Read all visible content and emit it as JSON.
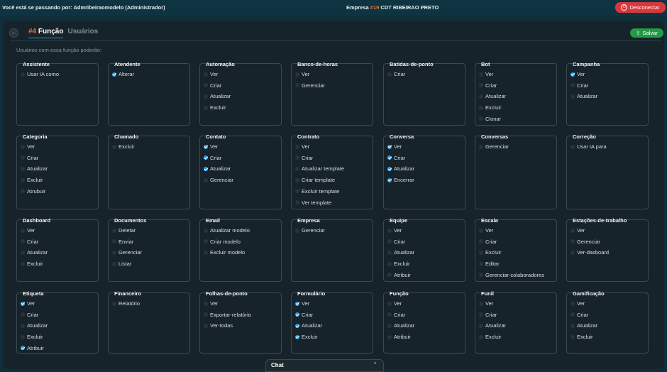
{
  "topbar": {
    "user_prefix": "Você está se passando por: ",
    "user_name": "Admribeiraomodelo (Administrador)",
    "company_prefix": "Empresa ",
    "company_num": "#19",
    "company_name": " CDT RIBEIRAO PRETO",
    "disconnect_label": "Desconectar"
  },
  "header": {
    "role_num": "#4",
    "tab_function": "Função",
    "tab_users": "Usuários",
    "save_label": "Salvar"
  },
  "subtitle": "Usuários com essa função poderão:",
  "colors": {
    "accent": "#2aa0e8",
    "danger": "#d6383c",
    "success": "#239a46",
    "orange": "#e2703a"
  },
  "cards": [
    {
      "title": "Assistente",
      "perms": [
        {
          "label": "Usar IA como",
          "on": false
        }
      ]
    },
    {
      "title": "Atendente",
      "perms": [
        {
          "label": "Alterar",
          "on": true
        }
      ]
    },
    {
      "title": "Automação",
      "perms": [
        {
          "label": "Ver",
          "on": false
        },
        {
          "label": "Criar",
          "on": false
        },
        {
          "label": "Atualizar",
          "on": false
        },
        {
          "label": "Excluir",
          "on": false
        }
      ]
    },
    {
      "title": "Banco-de-horas",
      "perms": [
        {
          "label": "Ver",
          "on": false
        },
        {
          "label": "Gerenciar",
          "on": false
        }
      ]
    },
    {
      "title": "Batidas-de-ponto",
      "perms": [
        {
          "label": "Criar",
          "on": false
        }
      ]
    },
    {
      "title": "Bot",
      "perms": [
        {
          "label": "Ver",
          "on": false
        },
        {
          "label": "Criar",
          "on": false
        },
        {
          "label": "Atualizar",
          "on": false
        },
        {
          "label": "Excluir",
          "on": false
        },
        {
          "label": "Clonar",
          "on": false
        }
      ]
    },
    {
      "title": "Campanha",
      "perms": [
        {
          "label": "Ver",
          "on": true
        },
        {
          "label": "Criar",
          "on": false
        },
        {
          "label": "Atualizar",
          "on": false
        }
      ]
    },
    {
      "title": "Categoria",
      "perms": [
        {
          "label": "Ver",
          "on": false
        },
        {
          "label": "Criar",
          "on": false
        },
        {
          "label": "Atualizar",
          "on": false
        },
        {
          "label": "Excluir",
          "on": false
        },
        {
          "label": "Atrubuir",
          "on": false
        }
      ]
    },
    {
      "title": "Chamado",
      "perms": [
        {
          "label": "Excluir",
          "on": false
        }
      ]
    },
    {
      "title": "Contato",
      "perms": [
        {
          "label": "Ver",
          "on": true
        },
        {
          "label": "Criar",
          "on": true
        },
        {
          "label": "Atualizar",
          "on": true
        },
        {
          "label": "Gerenciar",
          "on": false
        }
      ]
    },
    {
      "title": "Contrato",
      "perms": [
        {
          "label": "Ver",
          "on": false
        },
        {
          "label": "Criar",
          "on": false
        },
        {
          "label": "Atualizar template",
          "on": false
        },
        {
          "label": "Criar template",
          "on": false
        },
        {
          "label": "Excluir template",
          "on": false
        },
        {
          "label": "Ver template",
          "on": false
        }
      ]
    },
    {
      "title": "Conversa",
      "perms": [
        {
          "label": "Ver",
          "on": true
        },
        {
          "label": "Criar",
          "on": true
        },
        {
          "label": "Atualizar",
          "on": true
        },
        {
          "label": "Encerrar",
          "on": true
        }
      ]
    },
    {
      "title": "Conversas",
      "perms": [
        {
          "label": "Gerenciar",
          "on": false
        }
      ]
    },
    {
      "title": "Correção",
      "perms": [
        {
          "label": "Usar IA para",
          "on": false
        }
      ]
    },
    {
      "title": "Dashboard",
      "perms": [
        {
          "label": "Ver",
          "on": false
        },
        {
          "label": "Criar",
          "on": false
        },
        {
          "label": "Atualizar",
          "on": false
        },
        {
          "label": "Excluir",
          "on": false
        }
      ]
    },
    {
      "title": "Documentos",
      "perms": [
        {
          "label": "Deletar",
          "on": false
        },
        {
          "label": "Enviar",
          "on": false
        },
        {
          "label": "Gerenciar",
          "on": false
        },
        {
          "label": "Listar",
          "on": false
        }
      ]
    },
    {
      "title": "Email",
      "perms": [
        {
          "label": "Atualizar modelo",
          "on": false
        },
        {
          "label": "Criar modelo",
          "on": false
        },
        {
          "label": "Excluir modelo",
          "on": false
        }
      ]
    },
    {
      "title": "Empresa",
      "perms": [
        {
          "label": "Gerenciar",
          "on": false
        }
      ]
    },
    {
      "title": "Equipe",
      "perms": [
        {
          "label": "Ver",
          "on": false
        },
        {
          "label": "Criar",
          "on": false
        },
        {
          "label": "Atualizar",
          "on": false
        },
        {
          "label": "Excluir",
          "on": false
        },
        {
          "label": "Atribuir",
          "on": false
        }
      ]
    },
    {
      "title": "Escala",
      "perms": [
        {
          "label": "Ver",
          "on": false
        },
        {
          "label": "Criar",
          "on": false
        },
        {
          "label": "Excluir",
          "on": false
        },
        {
          "label": "Editar",
          "on": false
        },
        {
          "label": "Gerenciar-colaboradores",
          "on": false
        }
      ]
    },
    {
      "title": "Estações-de-trabalho",
      "perms": [
        {
          "label": "Ver",
          "on": false
        },
        {
          "label": "Gerenciar",
          "on": false
        },
        {
          "label": "Ver-dasboard",
          "on": false
        }
      ]
    },
    {
      "title": "Etiqueta",
      "perms": [
        {
          "label": "Ver",
          "on": true
        },
        {
          "label": "Criar",
          "on": false
        },
        {
          "label": "Atualizar",
          "on": false
        },
        {
          "label": "Excluir",
          "on": false
        },
        {
          "label": "Atribuir",
          "on": true
        }
      ]
    },
    {
      "title": "Financeiro",
      "perms": [
        {
          "label": "Relatório",
          "on": false
        }
      ]
    },
    {
      "title": "Folhas-de-ponto",
      "perms": [
        {
          "label": "Ver",
          "on": false
        },
        {
          "label": "Exportar-relatório",
          "on": false
        },
        {
          "label": "Ver-todas",
          "on": false
        }
      ]
    },
    {
      "title": "Formulário",
      "perms": [
        {
          "label": "Ver",
          "on": true
        },
        {
          "label": "Criar",
          "on": true
        },
        {
          "label": "Atualizar",
          "on": true
        },
        {
          "label": "Excluir",
          "on": true
        }
      ]
    },
    {
      "title": "Função",
      "perms": [
        {
          "label": "Ver",
          "on": false
        },
        {
          "label": "Criar",
          "on": false
        },
        {
          "label": "Atualizar",
          "on": false
        },
        {
          "label": "Atribuir",
          "on": false
        }
      ]
    },
    {
      "title": "Funil",
      "perms": [
        {
          "label": "Ver",
          "on": false
        },
        {
          "label": "Criar",
          "on": false
        },
        {
          "label": "Atualizar",
          "on": false
        },
        {
          "label": "Excluir",
          "on": false
        }
      ]
    },
    {
      "title": "Gamificação",
      "perms": [
        {
          "label": "Ver",
          "on": false
        },
        {
          "label": "Criar",
          "on": false
        },
        {
          "label": "Atualizar",
          "on": false
        },
        {
          "label": "Excluir",
          "on": false
        }
      ]
    }
  ],
  "chat": {
    "label": "Chat"
  }
}
